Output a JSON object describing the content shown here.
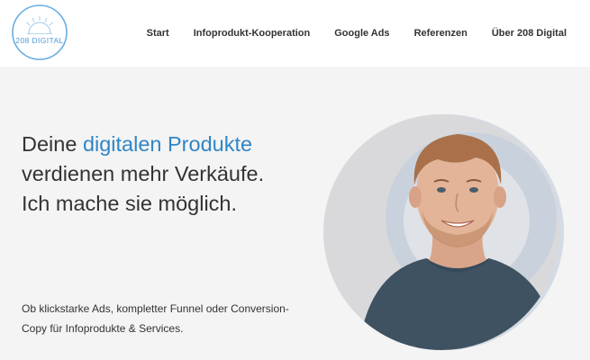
{
  "logo": {
    "text": "208 DIGITAL"
  },
  "nav": {
    "items": [
      {
        "label": "Start"
      },
      {
        "label": "Infoprodukt-Kooperation"
      },
      {
        "label": "Google Ads"
      },
      {
        "label": "Referenzen"
      },
      {
        "label": "Über 208 Digital"
      }
    ]
  },
  "hero": {
    "headline_part1": "Deine ",
    "headline_accent": "digitalen Produkte",
    "headline_line2": "verdienen mehr Verkäufe.",
    "headline_line3": "Ich mache sie möglich.",
    "subtext": "Ob klickstarke Ads, kompletter Funnel oder Conversion-Copy für Infoprodukte & Services."
  },
  "colors": {
    "accent": "#2f86c6",
    "logo": "#4f9bd6"
  }
}
